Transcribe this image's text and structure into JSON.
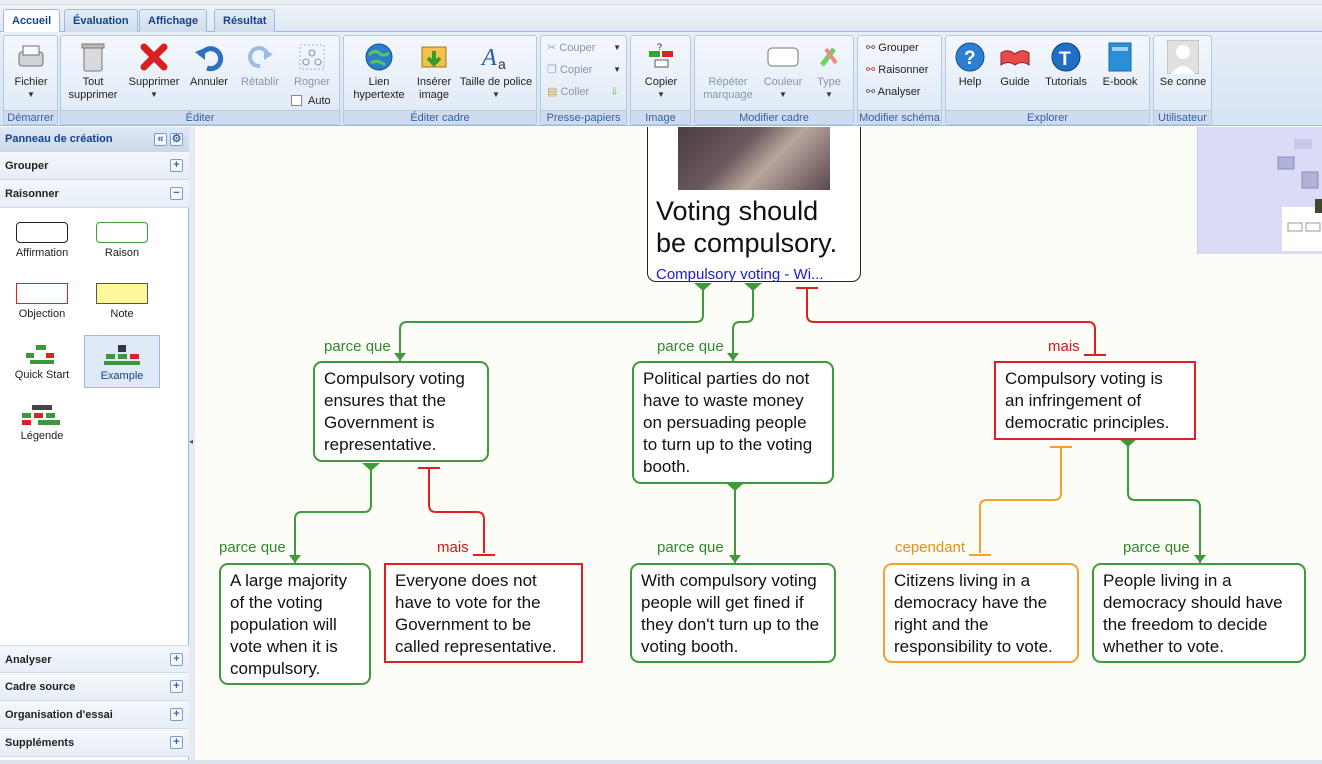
{
  "tabs": [
    {
      "label": "Accueil"
    },
    {
      "label": "Évaluation"
    },
    {
      "label": "Affichage"
    },
    {
      "label": "Résultat"
    }
  ],
  "ribbon": {
    "demarrer": {
      "title": "Démarrer",
      "fichier": "Fichier"
    },
    "editer": {
      "title": "Éditer",
      "tout": "Tout",
      "supprimer_l2": "supprimer",
      "supprimer": "Supprimer",
      "annuler": "Annuler",
      "retablir": "Rétablir",
      "rogner": "Rogner",
      "auto": "Auto"
    },
    "editer_cadre": {
      "title": "Éditer cadre",
      "lien": "Lien",
      "hypertexte": "hypertexte",
      "inserer": "Insérer",
      "image": "image",
      "taille": "Taille de police"
    },
    "presse": {
      "title": "Presse-papiers",
      "couper": "Couper",
      "copier": "Copier",
      "coller": "Coller"
    },
    "image": {
      "title": "Image",
      "copier": "Copier"
    },
    "modifier_cadre": {
      "title": "Modifier cadre",
      "repeter": "Répéter",
      "marquage": "marquage",
      "couleur": "Couleur",
      "type": "Type"
    },
    "modifier_schema": {
      "title": "Modifier schéma",
      "grouper": "Grouper",
      "raisonner": "Raisonner",
      "analyser": "Analyser"
    },
    "explorer": {
      "title": "Explorer",
      "help": "Help",
      "guide": "Guide",
      "tutorials": "Tutorials",
      "ebook": "E-book"
    },
    "utilisateur": {
      "title": "Utilisateur",
      "seconnecter": "Se conne"
    }
  },
  "panel": {
    "title": "Panneau de création",
    "sections": {
      "grouper": "Grouper",
      "raisonner": "Raisonner",
      "analyser": "Analyser",
      "cadre_source": "Cadre source",
      "organisation": "Organisation d'essai",
      "supplements": "Suppléments"
    },
    "items": {
      "affirmation": "Affirmation",
      "raison": "Raison",
      "objection": "Objection",
      "note": "Note",
      "quickstart": "Quick Start",
      "example": "Example",
      "legende": "Légende"
    }
  },
  "map": {
    "root": {
      "text": "Voting should be compulsory.",
      "link": "Compulsory voting - Wi..."
    },
    "labels": {
      "parce": "parce que",
      "mais": "mais",
      "cependant": "cependant"
    },
    "boxes": {
      "r1": "Compulsory voting ensures that the Government is representative.",
      "r2": "Political parties do not have to waste money on persuading people to turn up to the voting booth.",
      "o1": "Compulsory voting is an infringement of democratic principles.",
      "r1a": "A large majority of the voting population will vote when it is compulsory.",
      "o1a": "Everyone does not have to vote for the Government to be called representative.",
      "r2a": "With compulsory voting people will get fined if they don't turn up to the voting booth.",
      "c1": "Citizens living in a democracy have the right and the responsibility to vote.",
      "r3": "People living in a democracy should have the freedom to decide whether to vote."
    }
  },
  "colors": {
    "reason": "#3e9a3a",
    "objection": "#e02020",
    "rebuttal": "#f5a030",
    "accent": "#15428b"
  }
}
